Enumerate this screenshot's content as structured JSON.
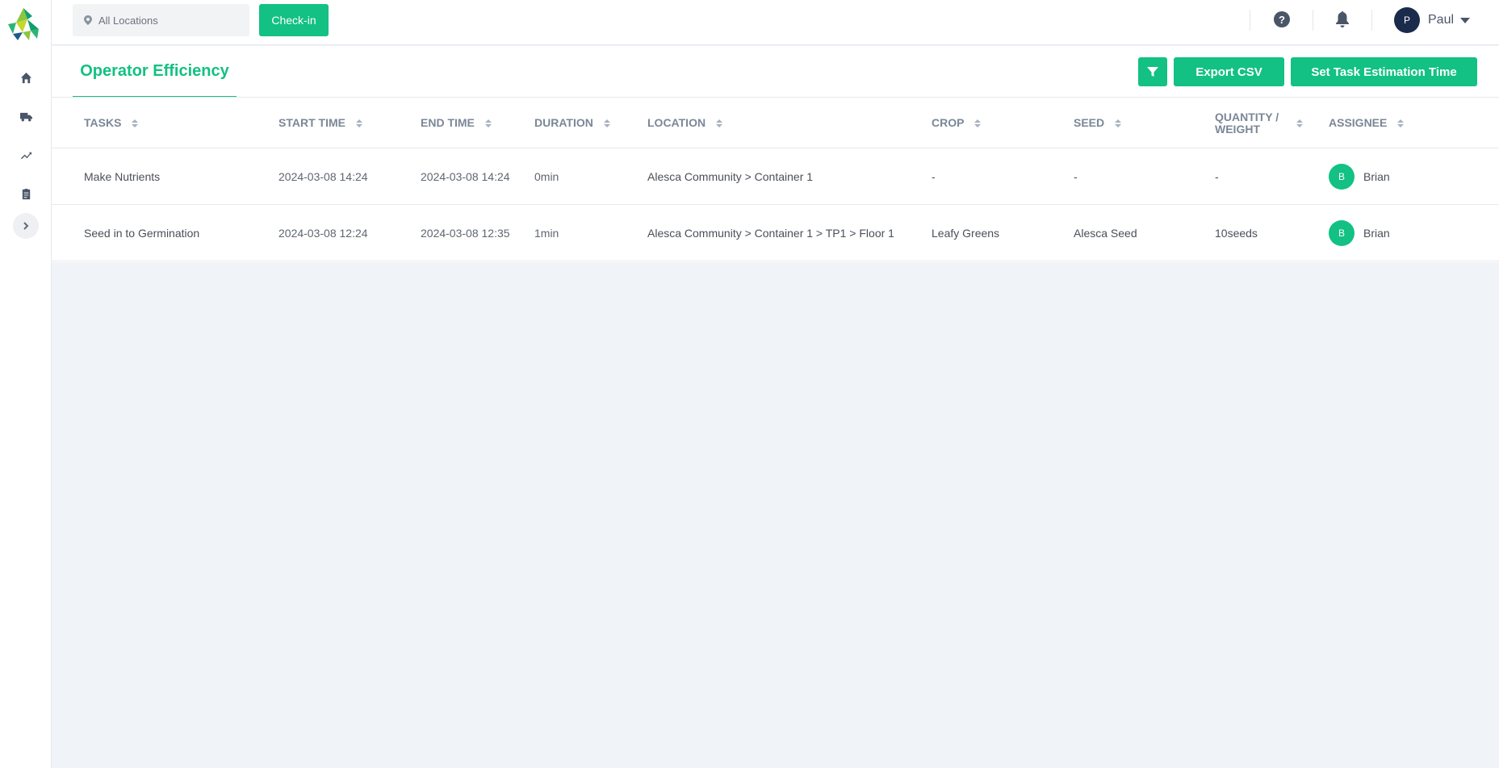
{
  "sidebar": {
    "logo": "leaf-triangle-logo",
    "items": [
      {
        "icon": "home-icon"
      },
      {
        "icon": "truck-icon"
      },
      {
        "icon": "trending-icon"
      },
      {
        "icon": "clipboard-icon"
      }
    ],
    "expand_icon": "chevron-right-icon"
  },
  "topbar": {
    "location_placeholder": "All Locations",
    "checkin_label": "Check-in",
    "help_label": "?",
    "user": {
      "initial": "P",
      "name": "Paul"
    }
  },
  "page": {
    "tab_label": "Operator Efficiency",
    "export_label": "Export CSV",
    "estimate_label": "Set Task Estimation Time"
  },
  "table": {
    "headers": {
      "tasks": "TASKS",
      "start": "START TIME",
      "end": "END TIME",
      "duration": "DURATION",
      "location": "LOCATION",
      "crop": "CROP",
      "seed": "SEED",
      "quantity_line1": "QUANTITY /",
      "quantity_line2": "WEIGHT",
      "assignee": "ASSIGNEE"
    },
    "rows": [
      {
        "task": "Make Nutrients",
        "start": "2024-03-08 14:24",
        "end": "2024-03-08 14:24",
        "duration": "0min",
        "location": "Alesca Community > Container 1",
        "crop": "-",
        "seed": "-",
        "quantity": "-",
        "assignee_initial": "B",
        "assignee": "Brian"
      },
      {
        "task": "Seed in to Germination",
        "start": "2024-03-08 12:24",
        "end": "2024-03-08 12:35",
        "duration": "1min",
        "location": "Alesca Community > Container 1 > TP1 > Floor 1",
        "crop": "Leafy Greens",
        "seed": "Alesca Seed",
        "quantity": "10seeds",
        "assignee_initial": "B",
        "assignee": "Brian"
      }
    ]
  },
  "colors": {
    "accent": "#12c183",
    "navy": "#1a2b4c",
    "background": "#f0f3f7"
  }
}
